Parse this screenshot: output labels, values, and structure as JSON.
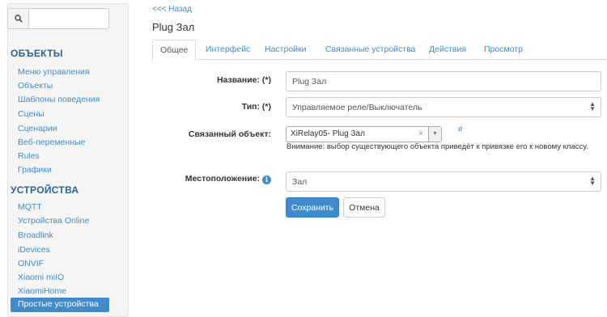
{
  "sidebar": {
    "search_icon": "search-icon",
    "sections": [
      {
        "title": "ОБЪЕКТЫ",
        "items": [
          "Меню управления",
          "Объекты",
          "Шаблоны поведения",
          "Сцены",
          "Сценарии",
          "Веб-переменные",
          "Rules",
          "Графики"
        ]
      },
      {
        "title": "УСТРОЙСТВА",
        "items": [
          "MQTT",
          "Устройства Online",
          "Broadlink",
          "iDevices",
          "ONVIF",
          "Xiaomi miIO",
          "XiaomiHome",
          "Простые устройства"
        ]
      }
    ],
    "active_item": "Простые устройства"
  },
  "main": {
    "back_link": "<<< Назад",
    "title": "Plug Зал",
    "tabs": [
      "Общее",
      "Интерфейс",
      "Настройки",
      "Связанные устройства",
      "Действия",
      "Просмотр"
    ],
    "active_tab": "Общее",
    "form": {
      "name_label": "Название: (*)",
      "name_value": "Plug Зал",
      "type_label": "Тип: (*)",
      "type_value": "Управляемое реле/Выключатель",
      "linked_object_label": "Связанный объект:",
      "linked_object_value": "XiRelay05- Plug Зал",
      "linked_object_clear": "×",
      "linked_object_hash": "#",
      "warning": "Внимание: выбор существующего объекта приведёт к привязке его к новому классу.",
      "location_label": "Местоположение:",
      "location_info_icon": "i",
      "location_value": "Зал",
      "save_label": "Сохранить",
      "cancel_label": "Отмена"
    }
  },
  "colors": {
    "accent": "#428bca",
    "section_header": "#2a6496",
    "sidebar_bg": "#f5f5f5"
  }
}
